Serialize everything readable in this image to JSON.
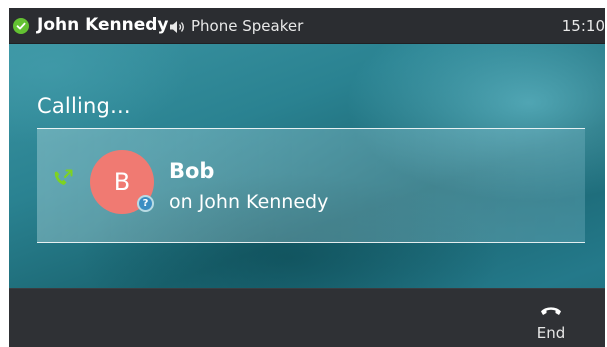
{
  "status_bar": {
    "account_name": "John Kennedy",
    "audio_mode": "Phone Speaker",
    "time": "15:10",
    "presence_icon": "check-circle-icon",
    "speaker_icon": "speaker-icon"
  },
  "call": {
    "state": "Calling...",
    "direction_icon": "outgoing-call-icon",
    "contact": {
      "name": "Bob",
      "initial": "B",
      "line": "on John Kennedy",
      "badge_icon": "question-mark-icon",
      "badge_glyph": "?",
      "avatar_color": "#f07a72"
    }
  },
  "softkeys": [
    {
      "label": "End",
      "icon": "hang-up-icon"
    }
  ],
  "colors": {
    "presence": "#63c132",
    "outgoing_icon": "#7ed321",
    "badge": "#3c8ec3"
  }
}
